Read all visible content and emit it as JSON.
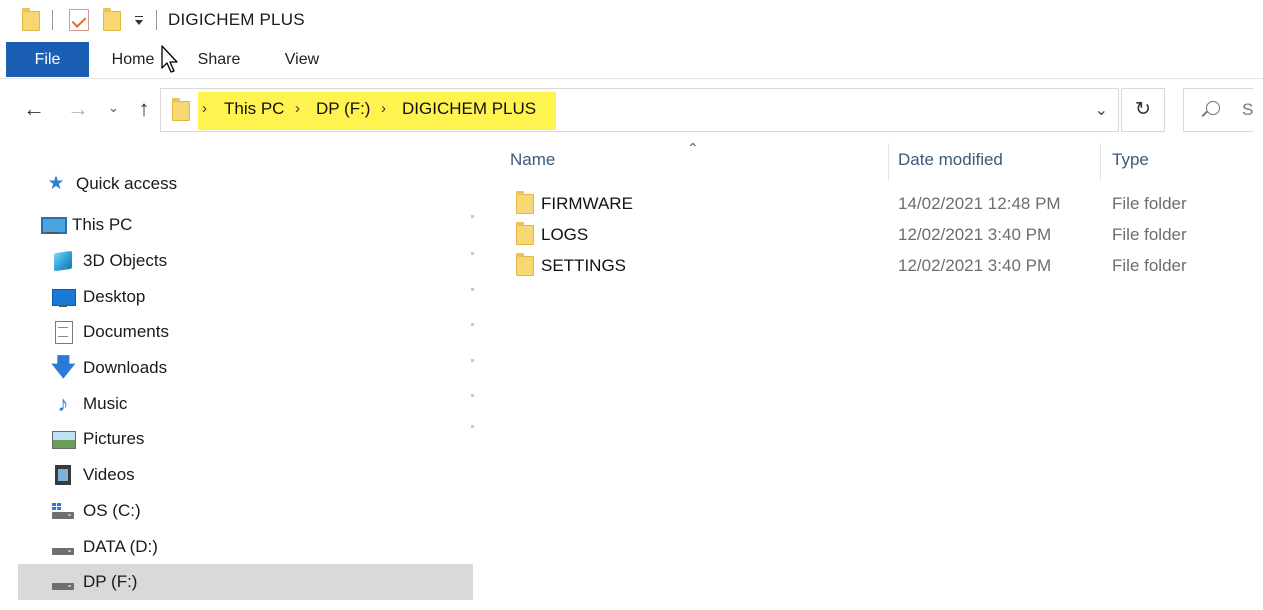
{
  "window": {
    "title": "DIGICHEM PLUS"
  },
  "ribbon": {
    "tabs": [
      {
        "label": "File"
      },
      {
        "label": "Home"
      },
      {
        "label": "Share"
      },
      {
        "label": "View"
      }
    ]
  },
  "address": {
    "crumbs": [
      "This PC",
      "DP (F:)",
      "DIGICHEM PLUS"
    ],
    "search_placeholder": "S",
    "highlight_color": "#fff44f"
  },
  "nav": {
    "items": [
      {
        "label": "Quick access",
        "icon": "star-icon"
      },
      {
        "label": "This PC",
        "icon": "computer-icon"
      },
      {
        "label": "3D Objects",
        "icon": "cube-icon"
      },
      {
        "label": "Desktop",
        "icon": "desktop-icon"
      },
      {
        "label": "Documents",
        "icon": "document-icon"
      },
      {
        "label": "Downloads",
        "icon": "download-arrow-icon"
      },
      {
        "label": "Music",
        "icon": "music-note-icon"
      },
      {
        "label": "Pictures",
        "icon": "picture-icon"
      },
      {
        "label": "Videos",
        "icon": "film-icon"
      },
      {
        "label": "OS (C:)",
        "icon": "os-drive-icon"
      },
      {
        "label": "DATA (D:)",
        "icon": "drive-icon"
      },
      {
        "label": "DP (F:)",
        "icon": "drive-icon",
        "selected": true
      }
    ]
  },
  "files": {
    "columns": {
      "name": "Name",
      "date": "Date modified",
      "type": "Type"
    },
    "rows": [
      {
        "name": "FIRMWARE",
        "date": "14/02/2021 12:48 PM",
        "type": "File folder"
      },
      {
        "name": "LOGS",
        "date": "12/02/2021 3:40 PM",
        "type": "File folder"
      },
      {
        "name": "SETTINGS",
        "date": "12/02/2021 3:40 PM",
        "type": "File folder"
      }
    ]
  },
  "colors": {
    "file_tab": "#1a5fb4",
    "selected_nav": "#d9d9d9",
    "folder": "#f7d774"
  }
}
